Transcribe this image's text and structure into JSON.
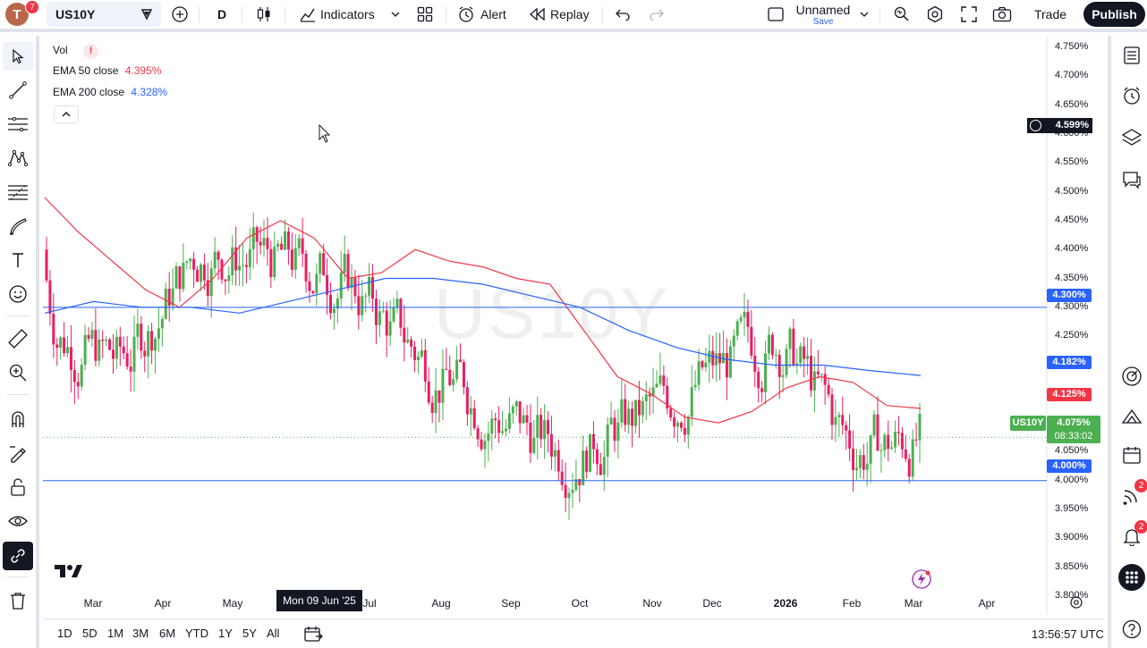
{
  "header": {
    "avatar_letter": "T",
    "avatar_badge": "7",
    "symbol": "US10Y",
    "interval": "D",
    "indicators_label": "Indicators",
    "alert_label": "Alert",
    "replay_label": "Replay",
    "layout_name": "Unnamed",
    "layout_save": "Save",
    "trade_label": "Trade",
    "publish_label": "Publish"
  },
  "legend": {
    "vol_label": "Vol",
    "vol_warning": "!",
    "ema50_label": "EMA 50 close",
    "ema50_value": "4.395%",
    "ema200_label": "EMA 200 close",
    "ema200_value": "4.328%"
  },
  "watermark": "US10Y",
  "price_axis": {
    "ticks": [
      "4.750%",
      "4.700%",
      "4.650%",
      "4.600%",
      "4.550%",
      "4.500%",
      "4.450%",
      "4.400%",
      "4.350%",
      "4.300%",
      "4.250%",
      "4.200%",
      "4.150%",
      "4.100%",
      "4.050%",
      "4.000%",
      "3.950%",
      "3.900%",
      "3.850%",
      "3.800%"
    ],
    "hover_price": "4.599%",
    "hline_upper": "4.300%",
    "ema200_tag": "4.182%",
    "ema50_tag": "4.125%",
    "symbol_tag": "US10Y",
    "current_price": "4.075%",
    "countdown": "08:33:02",
    "hline_lower": "4.000%"
  },
  "time_axis": {
    "ticks": [
      "Mar",
      "Apr",
      "May",
      "Jul",
      "Aug",
      "Sep",
      "Oct",
      "Nov",
      "Dec",
      "2026",
      "Feb",
      "Mar",
      "Apr"
    ],
    "crosshair_label": "Mon 09 Jun '25"
  },
  "bottom": {
    "ranges": [
      "1D",
      "5D",
      "1M",
      "3M",
      "6M",
      "YTD",
      "1Y",
      "5Y",
      "All"
    ],
    "clock": "13:56:57 UTC"
  },
  "right_badges": {
    "ideas": "2",
    "alerts": "2"
  },
  "colors": {
    "up": "#4caf50",
    "down": "#e91e63",
    "ema50": "#f23645",
    "ema200": "#2962ff",
    "hline": "#2962ff",
    "dark": "#131722"
  },
  "chart_data": {
    "type": "candlestick",
    "symbol": "US10Y",
    "interval": "D",
    "y_axis_unit": "%",
    "ylim": [
      3.78,
      4.77
    ],
    "horizontal_lines": [
      4.3,
      4.0
    ],
    "last_price": 4.075,
    "ema50_last": 4.125,
    "ema200_last": 4.182,
    "months": [
      "Mar",
      "Apr",
      "May",
      "Jun",
      "Jul",
      "Aug",
      "Sep",
      "Oct",
      "Nov",
      "Dec",
      "Jan",
      "Feb",
      "Mar"
    ],
    "closes_monthly_approx": [
      4.25,
      4.2,
      4.4,
      4.38,
      4.35,
      4.22,
      4.12,
      4.05,
      4.1,
      4.18,
      4.25,
      4.05,
      4.075
    ],
    "ema50_path": [
      4.49,
      4.43,
      4.38,
      4.33,
      4.3,
      4.35,
      4.42,
      4.45,
      4.42,
      4.35,
      4.36,
      4.4,
      4.38,
      4.37,
      4.35,
      4.34,
      4.26,
      4.18,
      4.15,
      4.11,
      4.1,
      4.12,
      4.16,
      4.18,
      4.17,
      4.13,
      4.125
    ],
    "ema200_path": [
      4.29,
      4.31,
      4.3,
      4.3,
      4.29,
      4.31,
      4.33,
      4.35,
      4.35,
      4.34,
      4.32,
      4.3,
      4.26,
      4.23,
      4.21,
      4.2,
      4.2,
      4.19,
      4.182
    ]
  }
}
